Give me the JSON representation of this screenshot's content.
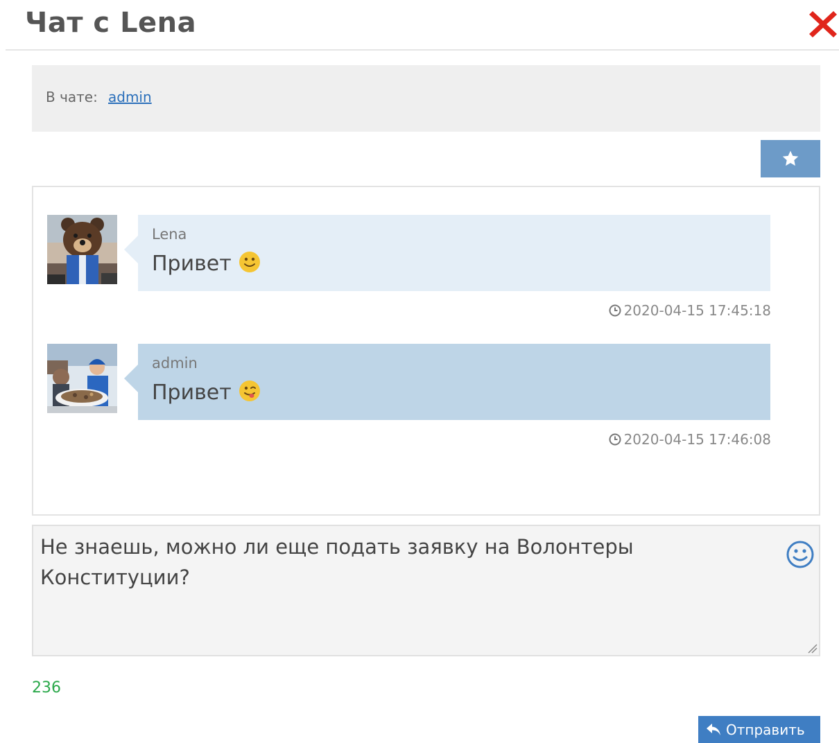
{
  "header": {
    "title": "Чат с Lena"
  },
  "participants": {
    "label": "В чате:",
    "user": "admin"
  },
  "messages": [
    {
      "author": "Lena",
      "text": "Привет",
      "emoji": "slightly-smiling-emoji",
      "timestamp": "2020-04-15 17:45:18"
    },
    {
      "author": "admin",
      "text": "Привет",
      "emoji": "winking-tongue-emoji",
      "timestamp": "2020-04-15 17:46:08"
    }
  ],
  "composer": {
    "value": "Не знаешь, можно ли еще подать заявку на Волонтеры Конституции?",
    "counter": "236"
  },
  "send_button": {
    "label": "Отправить"
  },
  "colors": {
    "own_bubble": "#e4eef7",
    "other_bubble": "#bed5e7",
    "primary_button": "#3f7ec3",
    "star_button": "#6d9bc8",
    "close_icon": "#e0251b",
    "counter": "#2aa84a"
  },
  "icons": [
    "close-icon",
    "star-icon",
    "clock-icon",
    "smiley-icon",
    "reply-icon"
  ]
}
